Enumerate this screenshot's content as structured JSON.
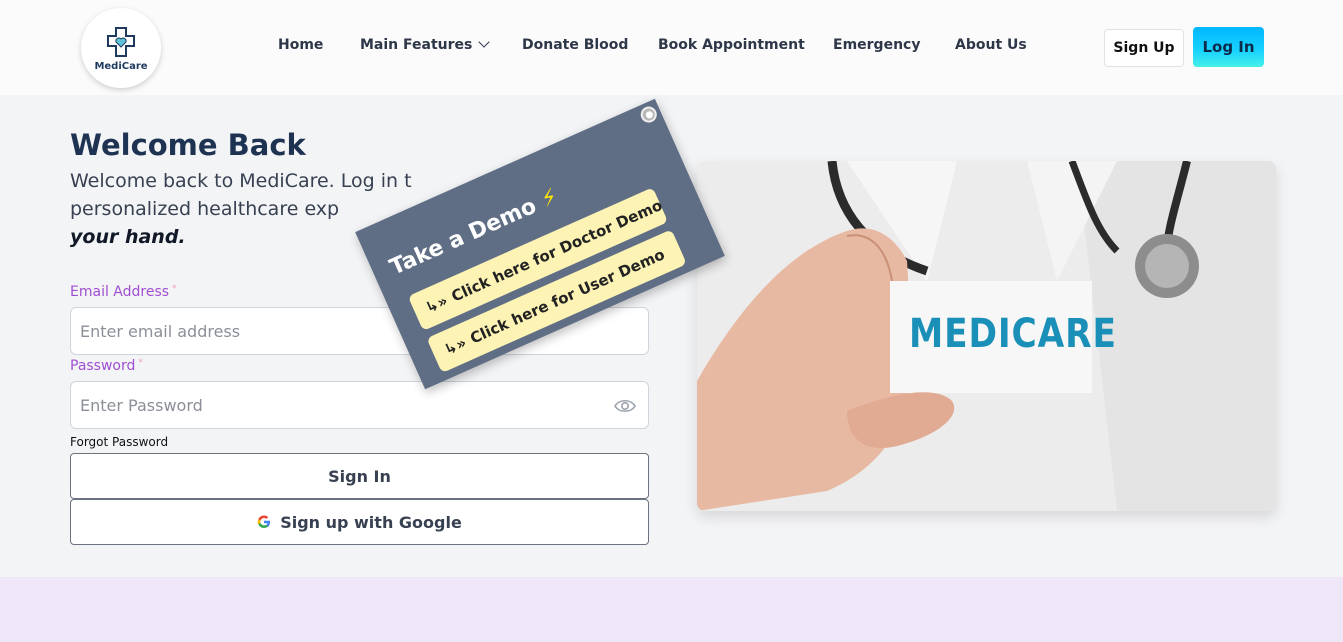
{
  "header": {
    "logo_text": "MediCare",
    "nav": [
      {
        "label": "Home"
      },
      {
        "label": "Main Features"
      },
      {
        "label": "Donate Blood"
      },
      {
        "label": "Book Appointment"
      },
      {
        "label": "Emergency"
      },
      {
        "label": "About Us"
      }
    ],
    "signup_label": "Sign Up",
    "login_label": "Log In"
  },
  "welcome": {
    "title": "Welcome Back",
    "subtitle_part1": "Welcome back to MediCare. Log in t",
    "subtitle_part2": "personalized healthcare exp",
    "subtitle_em": "your hand."
  },
  "form": {
    "email_label": "Email Address",
    "email_placeholder": "Enter email address",
    "password_label": "Password",
    "password_placeholder": "Enter Password",
    "required_mark": "*",
    "forgot_label": "Forgot Password",
    "signin_label": "Sign In",
    "google_label": "Sign up with Google"
  },
  "hero": {
    "card_text": "MEDICARE"
  },
  "demo": {
    "title": "Take a Demo",
    "bolt": "⚡",
    "doctor_label": "Click here for Doctor Demo",
    "user_label": "Click here for User Demo",
    "arrow": "↳»"
  },
  "colors": {
    "accent": "#00b7ff",
    "label": "#a04fd2",
    "title": "#1e3352",
    "demo_bg": "#5f6e84",
    "demo_btn": "#fcf3b5",
    "brand_text": "#1a8fb8"
  }
}
